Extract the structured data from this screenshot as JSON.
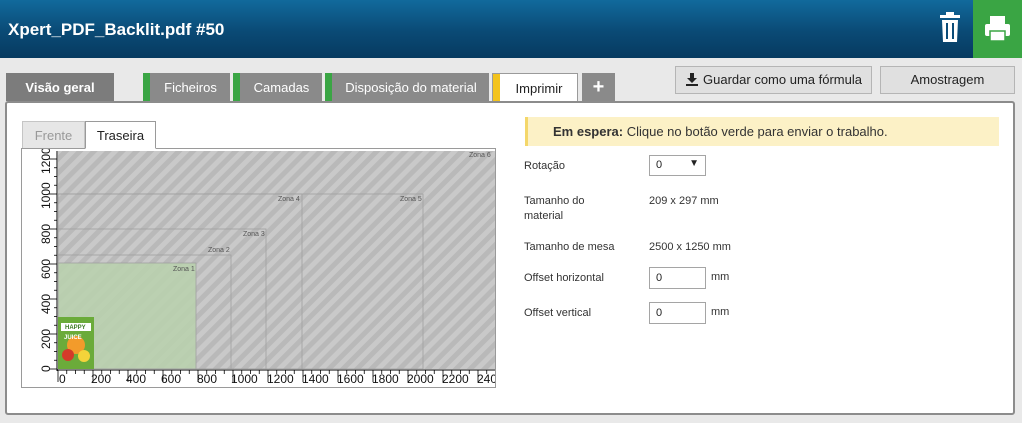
{
  "header": {
    "title": "Xpert_PDF_Backlit.pdf #50"
  },
  "tabs": [
    {
      "label": "Visão geral",
      "bar": ""
    },
    {
      "label": "Ficheiros",
      "bar": "#3aa544"
    },
    {
      "label": "Camadas",
      "bar": "#3aa544"
    },
    {
      "label": "Disposição do material",
      "bar": "#3aa544"
    },
    {
      "label": "Imprimir",
      "bar": "#f3c31c"
    },
    {
      "label": "+",
      "bar": ""
    }
  ],
  "actions": {
    "save_formula": "Guardar como uma fórmula",
    "sampling": "Amostragem"
  },
  "subtabs": {
    "front": "Frente",
    "back": "Traseira"
  },
  "status": {
    "label": "Em espera:",
    "message": "Clique no botão verde para enviar o trabalho."
  },
  "form": {
    "rotation_label": "Rotação",
    "rotation_value": "0",
    "material_size_label_1": "Tamanho do",
    "material_size_label_2": "material",
    "material_size_value": "209 x 297 mm",
    "table_size_label": "Tamanho de mesa",
    "table_size_value": "2500 x 1250 mm",
    "offset_h_label": "Offset horizontal",
    "offset_h_value": "0",
    "offset_v_label": "Offset vertical",
    "offset_v_value": "0",
    "unit": "mm"
  },
  "preview": {
    "x_ticks": [
      "0",
      "200",
      "400",
      "600",
      "800",
      "1000",
      "1200",
      "1400",
      "1600",
      "1800",
      "2000",
      "2200",
      "240"
    ],
    "y_ticks": [
      "0",
      "200",
      "400",
      "600",
      "800",
      "1000",
      "1200"
    ],
    "zones": [
      "Zona 1",
      "Zona 2",
      "Zona 3",
      "Zona 4",
      "Zona 5",
      "Zona 6"
    ],
    "thumb_text_1": "HAPPY",
    "thumb_text_2": "JUICE"
  }
}
